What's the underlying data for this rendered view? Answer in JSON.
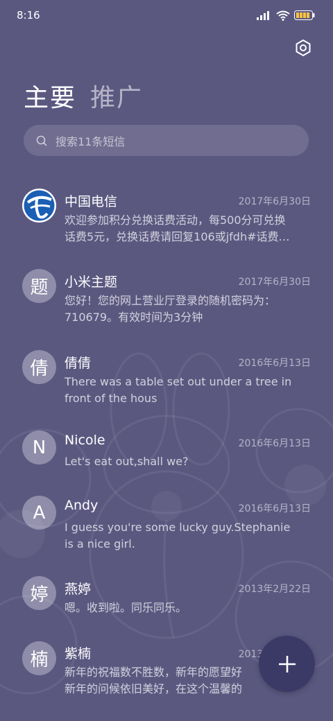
{
  "status_bar": {
    "time": "8:16",
    "signal_icon": "signal-icon",
    "wifi_icon": "wifi-icon",
    "battery_icon": "battery-icon"
  },
  "header": {
    "settings_icon": "gear-icon",
    "tabs": [
      {
        "label": "主要",
        "active": true
      },
      {
        "label": "推广",
        "active": false
      }
    ]
  },
  "search": {
    "placeholder": "搜索11条短信",
    "icon": "search-icon"
  },
  "conversations": [
    {
      "avatar": "",
      "avatar_icon": "china-telecom-logo",
      "name": "中国电信",
      "date": "2017年6月30日",
      "preview_lines": [
        "欢迎参加积分兑换话费活动，每500分可兑换",
        "话费5元，兑换话费请回复106或jfdh#话费…"
      ]
    },
    {
      "avatar": "题",
      "name": "小米主题",
      "date": "2017年6月30日",
      "preview_lines": [
        "您好！您的网上营业厅登录的随机密码为：",
        "710679。有效时间为3分钟"
      ]
    },
    {
      "avatar": "倩",
      "name": "倩倩",
      "date": "2016年6月13日",
      "preview_lines": [
        "There was a table set out under a tree in",
        "front of the hous"
      ]
    },
    {
      "avatar": "N",
      "name": "Nicole",
      "date": "2016年6月13日",
      "preview_lines": [
        "Let's eat out,shall we?"
      ]
    },
    {
      "avatar": "A",
      "name": "Andy",
      "date": "2016年6月13日",
      "preview_lines": [
        "I guess you're some lucky guy.Stephanie",
        "is a nice girl."
      ]
    },
    {
      "avatar": "婷",
      "name": "燕婷",
      "date": "2013年2月22日",
      "preview_lines": [
        "嗯。收到啦。同乐同乐。"
      ]
    },
    {
      "avatar": "楠",
      "name": "紫楠",
      "date": "2013年2月22日",
      "preview_lines": [
        "新年的祝福数不胜数，新年的愿望好",
        "新年的问候依旧美好，在这个温馨的"
      ]
    }
  ],
  "fab": {
    "icon": "plus-icon"
  },
  "colors": {
    "background": "#5b5880",
    "fab": "#3b3a67",
    "telecom_blue": "#1a5fb4"
  }
}
